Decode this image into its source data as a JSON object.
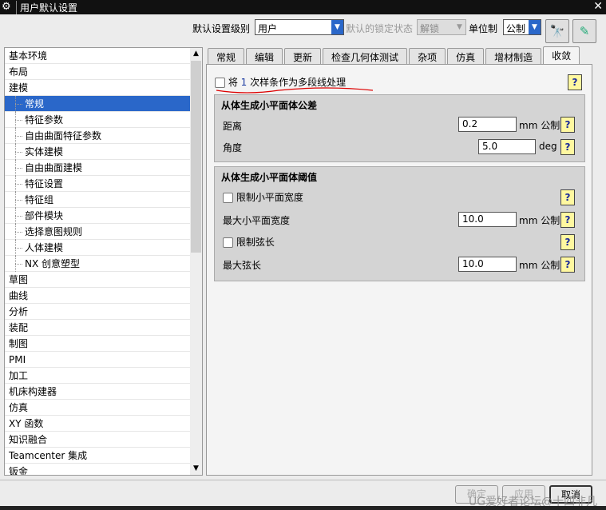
{
  "title": "用户默认设置",
  "toolbar": {
    "level_label": "默认设置级别",
    "level_value": "用户",
    "lock_label": "默认的锁定状态",
    "lock_value": "解锁",
    "unit_label": "单位制",
    "unit_value": "公制"
  },
  "tree": [
    "基本环境",
    "布局",
    "建模",
    "常规",
    "特征参数",
    "自由曲面特征参数",
    "实体建模",
    "自由曲面建模",
    "特征设置",
    "特征组",
    "部件模块",
    "选择意图规则",
    "人体建模",
    "NX 创意塑型",
    "草图",
    "曲线",
    "分析",
    "装配",
    "制图",
    "PMI",
    "加工",
    "机床构建器",
    "仿真",
    "XY 函数",
    "知识融合",
    "Teamcenter 集成",
    "钣金"
  ],
  "tabs": [
    "常规",
    "编辑",
    "更新",
    "检查几何体测试",
    "杂项",
    "仿真",
    "增材制造",
    "收敛"
  ],
  "panel": {
    "spline_pre": "将",
    "spline_num": "1",
    "spline_post": "次样条作为多段线处理",
    "g1_title": "从体生成小平面体公差",
    "distance_label": "距离",
    "distance_value": "0.2",
    "distance_unit": "mm 公制",
    "angle_label": "角度",
    "angle_value": "5.0",
    "angle_unit": "deg",
    "g2_title": "从体生成小平面体阈值",
    "limit_width_label": "限制小平面宽度",
    "max_width_label": "最大小平面宽度",
    "max_width_value": "10.0",
    "max_width_unit": "mm 公制",
    "limit_chord_label": "限制弦长",
    "max_chord_label": "最大弦长",
    "max_chord_value": "10.0",
    "max_chord_unit": "mm 公制",
    "help": "?"
  },
  "buttons": {
    "ok": "确定",
    "apply": "应用",
    "cancel": "取消"
  },
  "watermark": "UG爱好者论坛@十四非凡"
}
